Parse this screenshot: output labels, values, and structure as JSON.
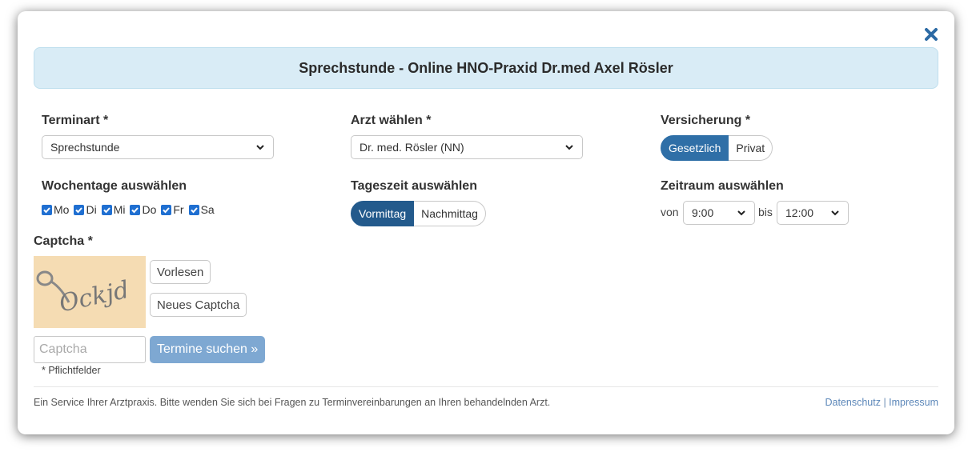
{
  "dialog": {
    "title": "Sprechstunde - Online HNO-Praxid Dr.med Axel Rösler"
  },
  "terminart": {
    "label": "Terminart *",
    "value": "Sprechstunde"
  },
  "arzt": {
    "label": "Arzt wählen *",
    "value": "Dr. med. Rösler (NN)"
  },
  "versicherung": {
    "label": "Versicherung *",
    "options": [
      "Gesetzlich",
      "Privat"
    ],
    "selected": "Gesetzlich"
  },
  "wochentage": {
    "label": "Wochentage auswählen",
    "days": [
      {
        "label": "Mo",
        "checked": true
      },
      {
        "label": "Di",
        "checked": true
      },
      {
        "label": "Mi",
        "checked": true
      },
      {
        "label": "Do",
        "checked": true
      },
      {
        "label": "Fr",
        "checked": true
      },
      {
        "label": "Sa",
        "checked": true
      }
    ]
  },
  "tageszeit": {
    "label": "Tageszeit auswählen",
    "options": [
      "Vormittag",
      "Nachmittag"
    ],
    "selected": "Vormittag"
  },
  "zeitraum": {
    "label": "Zeitraum auswählen",
    "from_label": "von",
    "from_value": "9:00",
    "to_label": "bis",
    "to_value": "12:00"
  },
  "captcha": {
    "label": "Captcha *",
    "image_text": "Ockjd",
    "read_aloud": "Vorlesen",
    "new_captcha": "Neues Captcha",
    "placeholder": "Captcha",
    "submit": "Termine suchen »",
    "required_note": "* Pflichtfelder"
  },
  "footer": {
    "text": "Ein Service Ihrer Arztpraxis. Bitte wenden Sie sich bei Fragen zu Terminvereinbarungen an Ihren behandelnden Arzt.",
    "privacy": "Datenschutz",
    "separator": "|",
    "imprint": "Impressum"
  },
  "colors": {
    "accent": "#2f6fa7",
    "banner_bg": "#d9ecf6",
    "captcha_bg": "#f5dcb3",
    "submit_bg": "#7ea8d2"
  }
}
